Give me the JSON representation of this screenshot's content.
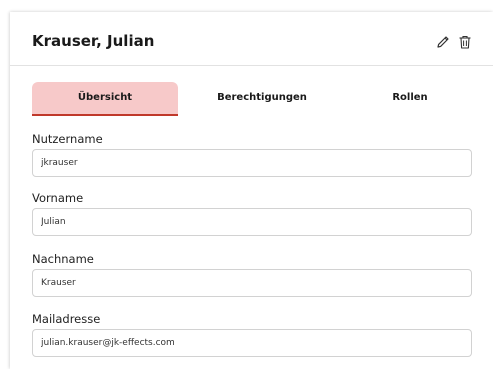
{
  "header": {
    "title": "Krauser, Julian",
    "edit_icon": "pencil-icon",
    "delete_icon": "trash-icon"
  },
  "tabs": [
    {
      "label": "Übersicht",
      "active": true
    },
    {
      "label": "Berechtigungen",
      "active": false
    },
    {
      "label": "Rollen",
      "active": false
    }
  ],
  "form": {
    "username": {
      "label": "Nutzername",
      "value": "jkrauser"
    },
    "first_name": {
      "label": "Vorname",
      "value": "Julian"
    },
    "last_name": {
      "label": "Nachname",
      "value": "Krauser"
    },
    "email": {
      "label": "Mailadresse",
      "value": "julian.krauser@jk-effects.com"
    }
  },
  "colors": {
    "active_tab_bg": "#f7c9c9",
    "active_tab_border": "#c0392b"
  }
}
